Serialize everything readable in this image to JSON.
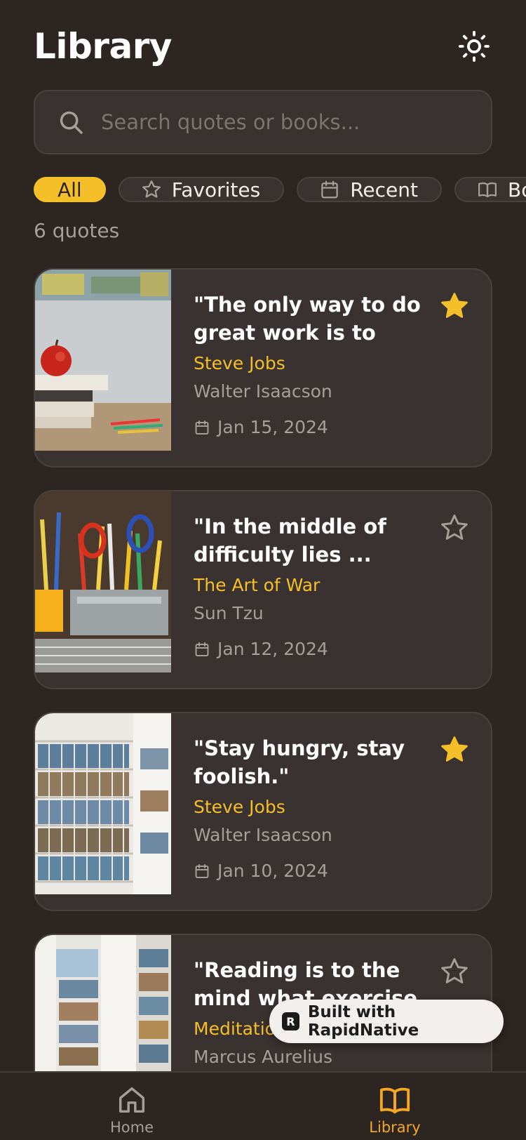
{
  "header": {
    "title": "Library",
    "theme_icon": "sun-icon"
  },
  "search": {
    "placeholder": "Search quotes or books...",
    "value": ""
  },
  "filters": [
    {
      "label": "All",
      "icon": "",
      "active": true
    },
    {
      "label": "Favorites",
      "icon": "star-icon",
      "active": false
    },
    {
      "label": "Recent",
      "icon": "calendar-icon",
      "active": false
    },
    {
      "label": "Books",
      "icon": "book-icon",
      "active": false
    }
  ],
  "count_text": "6 quotes",
  "quotes": [
    {
      "quote": "\"The only way to do great work is to love ...",
      "author": "Steve Jobs",
      "book": "Walter Isaacson",
      "date": "Jan 15, 2024",
      "favorite": true,
      "image": "apple-on-books-photo"
    },
    {
      "quote": "\"In the middle of difficulty lies ...",
      "author": "The Art of War",
      "book": "Sun Tzu",
      "date": "Jan 12, 2024",
      "favorite": false,
      "image": "pencil-cup-photo"
    },
    {
      "quote": "\"Stay hungry, stay foolish.\"",
      "author": "Steve Jobs",
      "book": "Walter Isaacson",
      "date": "Jan 10, 2024",
      "favorite": true,
      "image": "library-shelves-photo"
    },
    {
      "quote": "\"Reading is to the mind what exercise is to th...",
      "author": "Meditations",
      "book": "Marcus Aurelius",
      "date": "",
      "favorite": false,
      "image": "library-aisle-photo"
    }
  ],
  "badge": {
    "label": "Built with RapidNative"
  },
  "tabs": {
    "home": "Home",
    "library": "Library"
  },
  "colors": {
    "background": "#2d2522",
    "card": "#3a3230",
    "accent": "#f5bf2a",
    "muted": "#a79e9a"
  }
}
